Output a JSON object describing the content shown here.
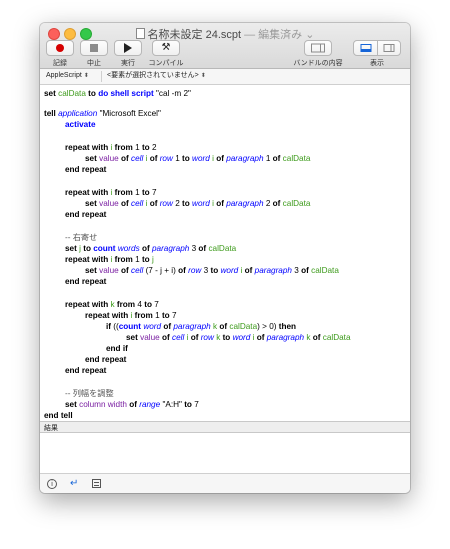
{
  "window": {
    "title": "名称未設定 24.scpt",
    "edited_label": "— 編集済み ⌄"
  },
  "toolbar": {
    "record_label": "記録",
    "stop_label": "中止",
    "run_label": "実行",
    "compile_label": "コンパイル",
    "bundle_label": "バンドルの内容",
    "view_label": "表示",
    "accent": "#1665d8",
    "record_color": "#d50000"
  },
  "navbar": {
    "language": "AppleScript",
    "element": "<要素が選択されていません>"
  },
  "script": {
    "l1_set": "set",
    "l1_var": "calData",
    "l1_to": "to",
    "l1_do": "do shell script",
    "l1_str": "\"cal -m 2\"",
    "l2_tell": "tell",
    "l2_app": "application",
    "l2_str": "\"Microsoft Excel\"",
    "l3": "activate",
    "l4_repeat": "repeat with",
    "l4_i": "i",
    "l4_from": "from",
    "l4_1": "1",
    "l4_to": "to",
    "l4_2": "2",
    "l5_set": "set",
    "l5_value": "value",
    "l5_of1": "of",
    "l5_cell": "cell",
    "l5_i": "i",
    "l5_of2": "of",
    "l5_row": "row",
    "l5_n1": "1",
    "l5_to": "to",
    "l5_word": "word",
    "l5_i2": "i",
    "l5_of3": "of",
    "l5_paragraph": "paragraph",
    "l5_n2": "1",
    "l5_of4": "of",
    "l5_var": "calData",
    "end_repeat": "end repeat",
    "l6_7": "7",
    "l7_row_n": "2",
    "l7_par_n": "2",
    "c1": "-- 右寄せ",
    "l8_set": "set",
    "l8_j": "j",
    "l8_to": "to",
    "l8_count": "count",
    "l8_words": "words",
    "l8_of1": "of",
    "l8_par": "paragraph",
    "l8_n": "3",
    "l8_of2": "of",
    "l8_var": "calData",
    "l9_to_j": "j",
    "l10_cellexpr": "(7 - j + i)",
    "l10_row_n": "3",
    "l10_par_n": "3",
    "l11_k": "k",
    "l11_from_n": "4",
    "l11_to_n": "7",
    "l13_if": "if",
    "l13_count": "count",
    "l13_word": "word",
    "l13_of": "of",
    "l13_par": "paragraph",
    "l13_k": "k",
    "l13_rest": "of",
    "l13_var": "calData",
    "l13_gt": ") > 0)",
    "l13_then": "then",
    "end_if": "end if",
    "c2": "-- 列幅を調整",
    "l16_set": "set",
    "l16_column": "column width",
    "l16_of": "of",
    "l16_range": "range",
    "l16_str": "\"A:H\"",
    "l16_to": "to",
    "l16_n": "7",
    "end_tell": "end tell"
  },
  "results": {
    "label": "結果"
  }
}
